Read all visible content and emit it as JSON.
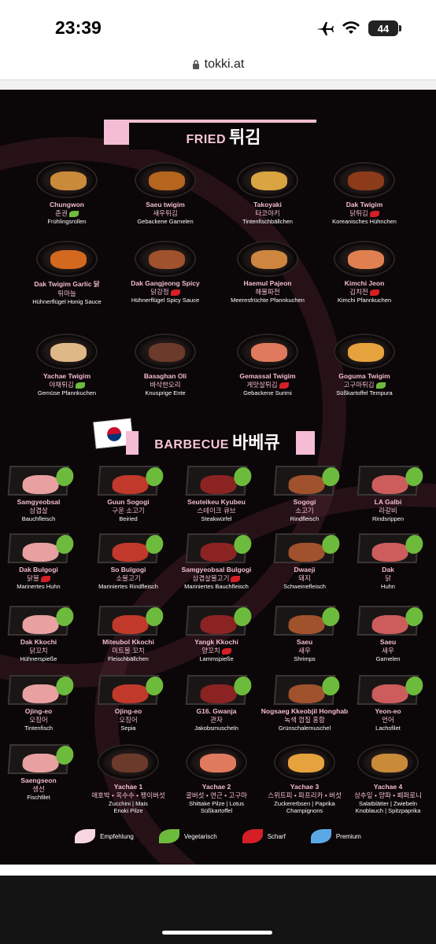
{
  "status": {
    "time": "23:39",
    "battery": "44"
  },
  "browser": {
    "url": "tokki.at"
  },
  "colors": {
    "accent_pink": "#f4bdd3",
    "background": "#0b0607",
    "vegetarian": "#6dbb3c",
    "spicy": "#d41f26",
    "premium": "#5aa9e6"
  },
  "sections": {
    "fried": {
      "en": "FRIED",
      "ko": "튀김"
    },
    "bbq": {
      "en": "BARBECUE",
      "ko": "바베큐"
    }
  },
  "fried_items": [
    {
      "name": "Chungwon",
      "ko": "춘권",
      "de": "Frühlingsrollen",
      "tag": "vegetarian"
    },
    {
      "name": "Saeu twigim",
      "ko": "새우튀김",
      "de": "Gebackene Garnelen",
      "tag": ""
    },
    {
      "name": "Takoyaki",
      "ko": "타코야키",
      "de": "Tintenfischbällchen",
      "tag": ""
    },
    {
      "name": "Dak Twigim",
      "ko": "닭튀김",
      "de": "Koreanisches Hühnchen",
      "tag": "spicy"
    },
    {
      "name": "Dak Twigim Garlic 닭",
      "ko": "튀마늘",
      "de": "Hühnerflügel Honig Sauce",
      "tag": ""
    },
    {
      "name": "Dak Gangjeong Spicy",
      "ko": "닭강정",
      "de": "Hühnerflügel Spicy Sauce",
      "tag": "spicy"
    },
    {
      "name": "Haemul Pajeon",
      "ko": "해물파전",
      "de": "Meeresfrüchte Pfannkuchen",
      "tag": ""
    },
    {
      "name": "Kimchi Jeon",
      "ko": "김치전",
      "de": "Kimchi Pfannkuchen",
      "tag": "spicy"
    },
    {
      "name": "Yachae Twigim",
      "ko": "야채튀김",
      "de": "Gemüse Pfannkuchen",
      "tag": "vegetarian"
    },
    {
      "name": "Basaghan Oli",
      "ko": "바삭한오리",
      "de": "Knusprige Ente",
      "tag": ""
    },
    {
      "name": "Gemassal Twigim",
      "ko": "게맛살튀김",
      "de": "Gebackene Surimi",
      "tag": "spicy"
    },
    {
      "name": "Goguma Twigim",
      "ko": "고구마튀김",
      "de": "Süßkartoffel Tempura",
      "tag": "vegetarian"
    }
  ],
  "bbq_items": [
    {
      "name": "Samgyeobsal",
      "ko": "삼겹살",
      "de": "Bauchfleisch",
      "tag": ""
    },
    {
      "name": "Guun Sogogi",
      "ko": "구운 소고기",
      "de": "Beiried",
      "tag": ""
    },
    {
      "name": "Seuteikeu Kyubeu",
      "ko": "스테이크 큐브",
      "de": "Steakwürfel",
      "tag": ""
    },
    {
      "name": "Sogogi",
      "ko": "소고기",
      "de": "Rindfleisch",
      "tag": ""
    },
    {
      "name": "LA Galbi",
      "ko": "라갈비",
      "de": "Rindsrippen",
      "tag": ""
    },
    {
      "name": "Dak Bulgogi",
      "ko": "닭불",
      "de": "Marinertes Huhn",
      "tag": "spicy"
    },
    {
      "name": "So Bulgogi",
      "ko": "소불고기",
      "de": "Mariniertes Rindfleisch",
      "tag": ""
    },
    {
      "name": "Samgyeobsal Bulgogi",
      "ko": "삼겹살불고기",
      "de": "Mariniertes Bauchfleisch",
      "tag": "spicy"
    },
    {
      "name": "Dwaeji",
      "ko": "돼지",
      "de": "Schweinefleisch",
      "tag": ""
    },
    {
      "name": "Dak",
      "ko": "닭",
      "de": "Huhn",
      "tag": ""
    },
    {
      "name": "Dak Kkochi",
      "ko": "닭꼬치",
      "de": "Hühnerspieße",
      "tag": ""
    },
    {
      "name": "Miteubol Kkochi",
      "ko": "미트볼 꼬치",
      "de": "Fleischbällchen",
      "tag": ""
    },
    {
      "name": "Yangk Kkochi",
      "ko": "양꼬치",
      "de": "Lammspieße",
      "tag": "spicy"
    },
    {
      "name": "Saeu",
      "ko": "새우",
      "de": "Shrimps",
      "tag": ""
    },
    {
      "name": "Saeu",
      "ko": "새우",
      "de": "Garnelen",
      "tag": ""
    },
    {
      "name": "Ojing-eo",
      "ko": "오징어",
      "de": "Tintenfisch",
      "tag": ""
    },
    {
      "name": "Ojing-eo",
      "ko": "오징어",
      "de": "Sepia",
      "tag": ""
    },
    {
      "name": "G16. Gwanja",
      "ko": "관자",
      "de": "Jakobsmuscheln",
      "tag": ""
    },
    {
      "name": "Nogsaeg Kkeobjil Honghab",
      "ko": "녹색 껍질 홍합",
      "de": "Grünschalemuschel",
      "tag": ""
    },
    {
      "name": "Yeon-eo",
      "ko": "언어",
      "de": "Lachsfilet",
      "tag": ""
    },
    {
      "name": "Saengseon",
      "ko": "생선",
      "de": "Fischfilet",
      "tag": ""
    },
    {
      "name": "Yachae 1",
      "ko": "애호박 • 옥수수 • 팽이버섯",
      "de": "Zucchini | Mais\nEnoki Pilze",
      "tag": ""
    },
    {
      "name": "Yachae 2",
      "ko": "굴버섯 • 연근 • 고구마",
      "de": "Shittake Pilze | Lotus\nSüßkartoffel",
      "tag": ""
    },
    {
      "name": "Yachae 3",
      "ko": "스위트피 • 파프리카 • 버섯",
      "de": "Zuckererbsen | Paprika\nChampignons",
      "tag": ""
    },
    {
      "name": "Yachae 4",
      "ko": "상추잎 • 양파 • 페퍼로니",
      "de": "Salatblätter | Zwiebeln\nKnoblauch | Spitzpaprika",
      "tag": ""
    }
  ],
  "legend": [
    {
      "label": "Empfehlung",
      "color": "#f7d6e2"
    },
    {
      "label": "Vegetarisch",
      "color": "#6dbb3c"
    },
    {
      "label": "Scharf",
      "color": "#d41f26"
    },
    {
      "label": "Premium",
      "color": "#5aa9e6"
    }
  ]
}
